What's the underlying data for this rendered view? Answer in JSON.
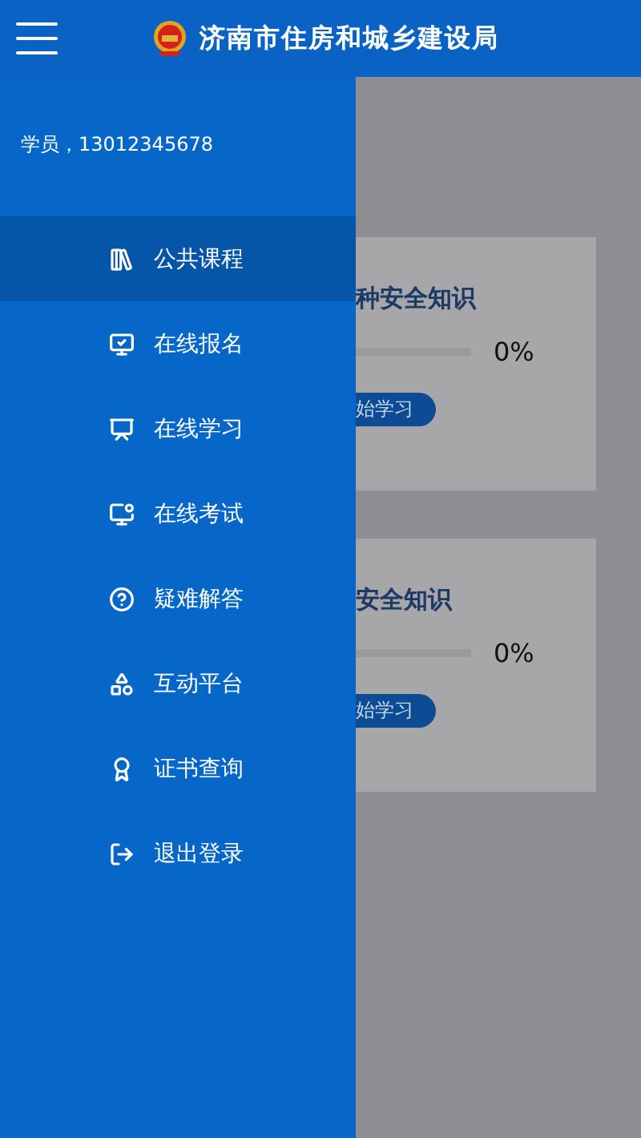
{
  "header": {
    "title": "济南市住房和城乡建设局"
  },
  "drawer": {
    "user": "学员，13012345678",
    "items": [
      {
        "label": "公共课程",
        "selected": true
      },
      {
        "label": "在线报名",
        "selected": false
      },
      {
        "label": "在线学习",
        "selected": false
      },
      {
        "label": "在线考试",
        "selected": false
      },
      {
        "label": "疑难解答",
        "selected": false
      },
      {
        "label": "互动平台",
        "selected": false
      },
      {
        "label": "证书查询",
        "selected": false
      },
      {
        "label": "退出登录",
        "selected": false
      }
    ]
  },
  "courses": [
    {
      "title": "种安全知识",
      "level": 0,
      "reading": "0%",
      "button": "始学习"
    },
    {
      "title": "安全知识",
      "level": 0,
      "reading": "0%",
      "button": "始学习"
    }
  ]
}
